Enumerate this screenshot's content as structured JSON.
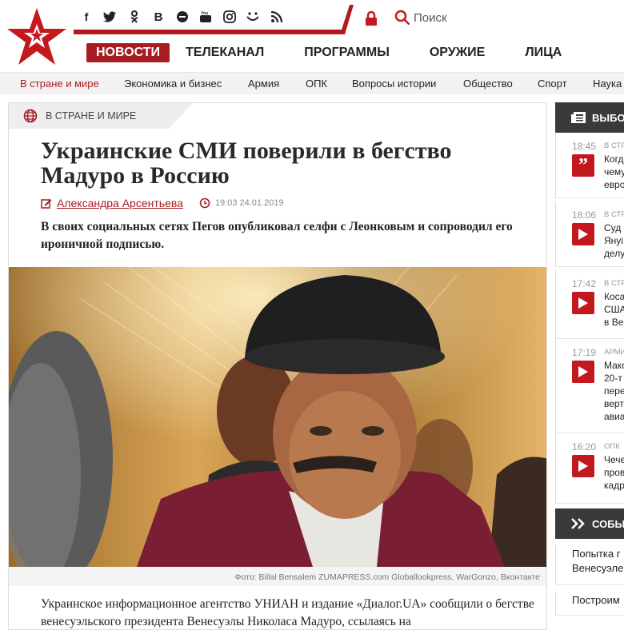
{
  "header": {
    "social_icons": [
      "facebook-icon",
      "twitter-icon",
      "odnoklassniki-icon",
      "vk-icon",
      "messenger-icon",
      "youtube-icon",
      "instagram-icon",
      "emoji-icon",
      "rss-icon"
    ],
    "search_label": "Поиск",
    "nav": [
      "НОВОСТИ",
      "ТЕЛЕКАНАЛ",
      "ПРОГРАММЫ",
      "ОРУЖИЕ",
      "ЛИЦА"
    ],
    "brand_color": "#a71c22"
  },
  "subnav": [
    "В стране и мире",
    "Экономика и бизнес",
    "Армия",
    "ОПК",
    "Вопросы истории",
    "Общество",
    "Спорт",
    "Наука"
  ],
  "article": {
    "category": "В СТРАНЕ И МИРЕ",
    "title": "Украинские СМИ поверили в бегство Мадуро в Россию",
    "author": "Александра Арсентьева",
    "date": "19:03 24.01.2019",
    "lead": "В своих социальных сетях Пегов опубликовал селфи с Леонковым и сопроводил его ироничной подписью.",
    "caption": "Фото: Billal Bensalem ZUMAPRESS.com Globallookpress, WarGonzo, Вконтакте",
    "body": "Украинское информационное агентство УНИАН и издание «Диалог.UA» сообщили о бегстве венесуэльского президента Венесуэлы Николаса Мадуро, ссылаясь на"
  },
  "sidebar": {
    "header": "ВЫБОР",
    "news": [
      {
        "time": "18:45",
        "cat": "В СТР",
        "lines": [
          "Когд",
          "чему",
          "евро"
        ],
        "icon": "quote-icon"
      },
      {
        "time": "18:06",
        "cat": "В СТР",
        "lines": [
          "Суд",
          "Януі",
          "делу"
        ],
        "icon": "play-icon"
      },
      {
        "time": "17:42",
        "cat": "В СТР",
        "lines": [
          "Коса",
          "США",
          "в Ве"
        ],
        "icon": "play-icon"
      },
      {
        "time": "17:19",
        "cat": "АРМИ",
        "lines": [
          "Мако",
          "20-т",
          "пере",
          "верт",
          "авиа"
        ],
        "icon": "play-icon"
      },
      {
        "time": "16:20",
        "cat": "ОПК",
        "lines": [
          "Чече",
          "пров",
          "кадр"
        ],
        "icon": "play-icon"
      }
    ],
    "events_header": "СОБЫ",
    "events": [
      "Попытка г",
      "Венесуэле",
      "Построим"
    ]
  }
}
